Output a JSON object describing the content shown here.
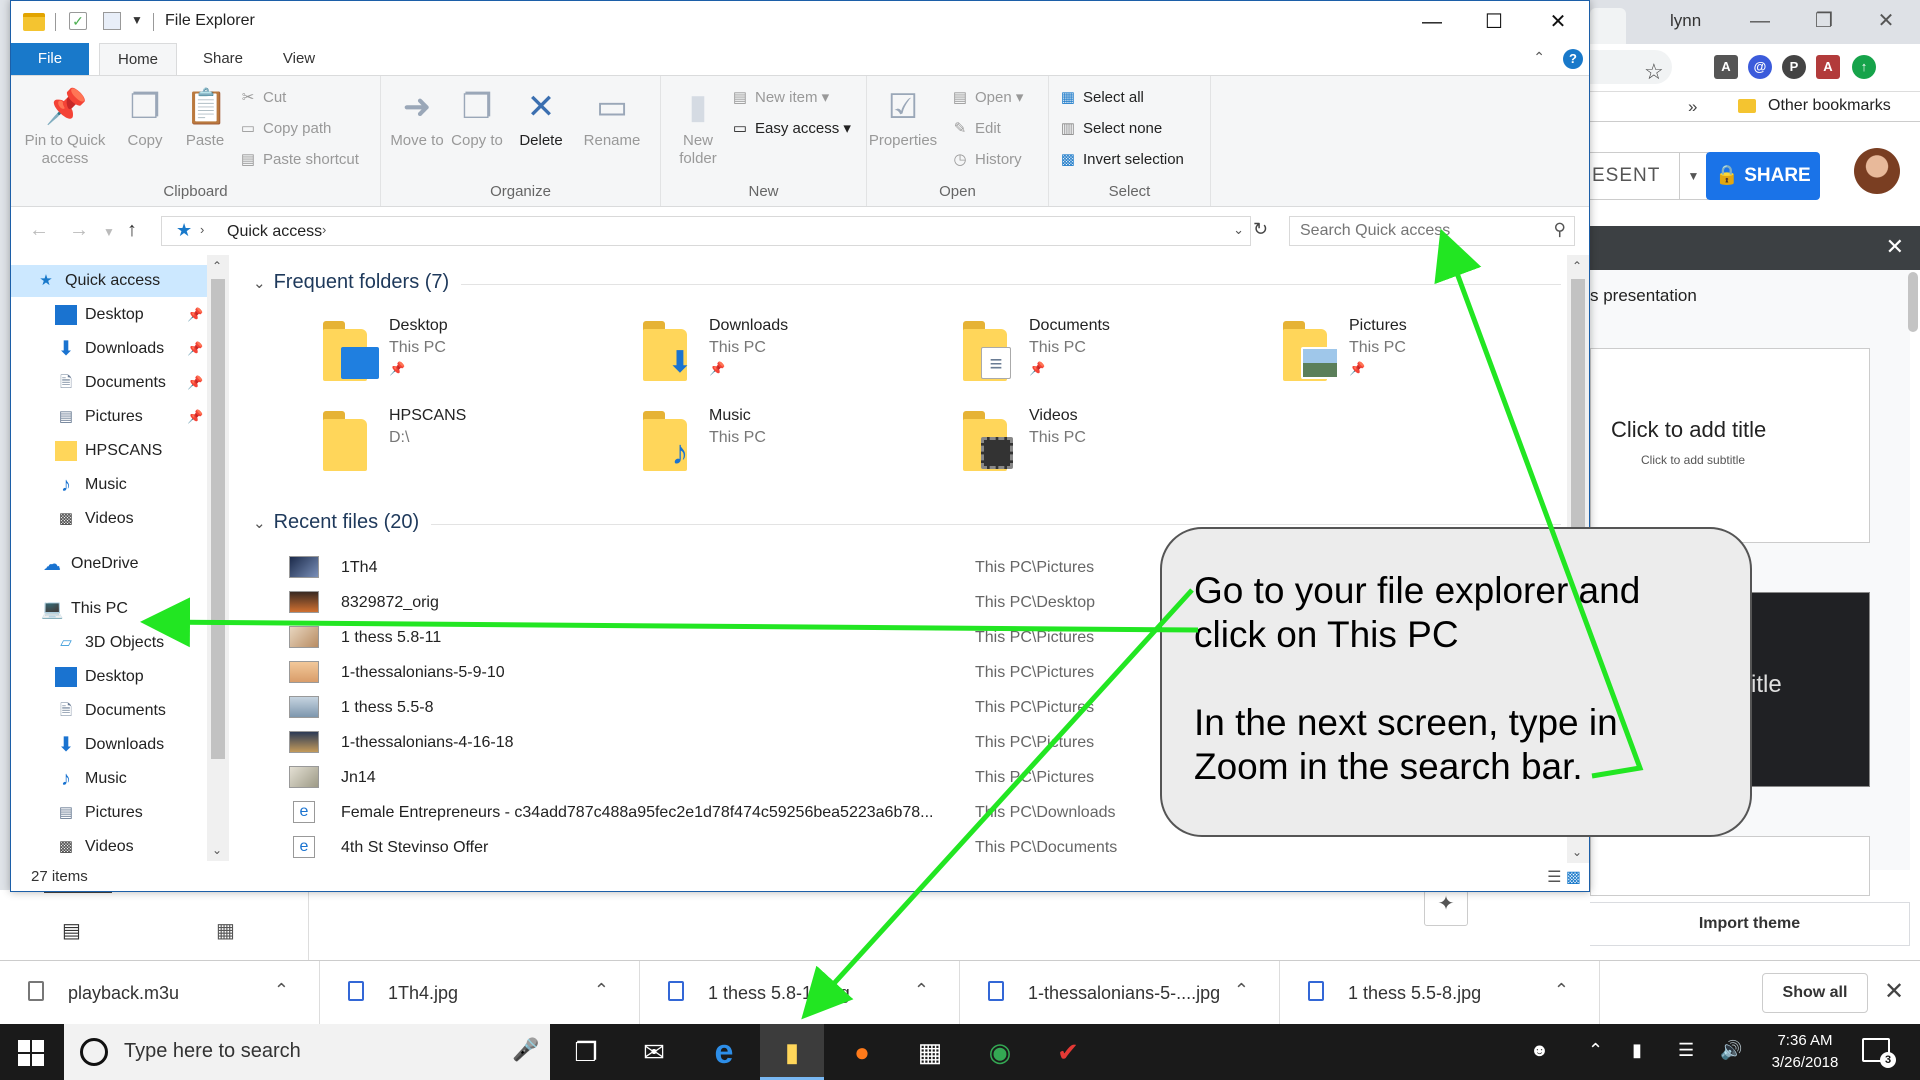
{
  "chrome": {
    "profile_name": "lynn",
    "bookmark_folder": "Other bookmarks",
    "slides": {
      "present_label": "ESENT",
      "share_label": "SHARE",
      "themes_title": "s presentation",
      "slide1_title": "Click to add title",
      "slide1_subtitle": "Click to add subtitle",
      "slide2_title": "itle",
      "import_theme": "Import theme"
    }
  },
  "explorer": {
    "title": "File Explorer",
    "tabs": [
      "File",
      "Home",
      "Share",
      "View"
    ],
    "ribbon": {
      "clipboard": {
        "label": "Clipboard",
        "pin": "Pin to Quick access",
        "copy": "Copy",
        "paste": "Paste",
        "cut": "Cut",
        "copy_path": "Copy path",
        "paste_shortcut": "Paste shortcut"
      },
      "organize": {
        "label": "Organize",
        "move_to": "Move to",
        "copy_to": "Copy to",
        "delete": "Delete",
        "rename": "Rename"
      },
      "new": {
        "label": "New",
        "new_folder": "New folder",
        "new_item": "New item",
        "easy_access": "Easy access"
      },
      "open": {
        "label": "Open",
        "properties": "Properties",
        "open": "Open",
        "edit": "Edit",
        "history": "History"
      },
      "select": {
        "label": "Select",
        "select_all": "Select all",
        "select_none": "Select none",
        "invert_selection": "Invert selection"
      }
    },
    "address": {
      "path": "Quick access",
      "search_placeholder": "Search Quick access"
    },
    "nav": [
      {
        "label": "Quick access",
        "icon": "star-icon"
      },
      {
        "label": "Desktop",
        "icon": "desktop-icon"
      },
      {
        "label": "Downloads",
        "icon": "download-icon"
      },
      {
        "label": "Documents",
        "icon": "documents-icon"
      },
      {
        "label": "Pictures",
        "icon": "pictures-icon"
      },
      {
        "label": "HPSCANS",
        "icon": "folder-icon"
      },
      {
        "label": "Music",
        "icon": "music-icon"
      },
      {
        "label": "Videos",
        "icon": "videos-icon"
      },
      {
        "label": "OneDrive",
        "icon": "onedrive-icon"
      },
      {
        "label": "This PC",
        "icon": "computer-icon"
      },
      {
        "label": "3D Objects",
        "icon": "3d-objects-icon"
      },
      {
        "label": "Desktop",
        "icon": "desktop-icon"
      },
      {
        "label": "Documents",
        "icon": "documents-icon"
      },
      {
        "label": "Downloads",
        "icon": "download-icon"
      },
      {
        "label": "Music",
        "icon": "music-icon"
      },
      {
        "label": "Pictures",
        "icon": "pictures-icon"
      },
      {
        "label": "Videos",
        "icon": "videos-icon"
      }
    ],
    "frequent_header": "Frequent folders (7)",
    "frequent": [
      {
        "name": "Desktop",
        "location": "This PC",
        "pinned": true
      },
      {
        "name": "Downloads",
        "location": "This PC",
        "pinned": true
      },
      {
        "name": "Documents",
        "location": "This PC",
        "pinned": true
      },
      {
        "name": "Pictures",
        "location": "This PC",
        "pinned": true
      },
      {
        "name": "HPSCANS",
        "location": "D:\\",
        "pinned": false
      },
      {
        "name": "Music",
        "location": "This PC",
        "pinned": false
      },
      {
        "name": "Videos",
        "location": "This PC",
        "pinned": false
      }
    ],
    "recent_header": "Recent files (20)",
    "recent": [
      {
        "name": "1Th4",
        "location": "This PC\\Pictures"
      },
      {
        "name": "8329872_orig",
        "location": "This PC\\Desktop"
      },
      {
        "name": "1 thess 5.8-11",
        "location": "This PC\\Pictures"
      },
      {
        "name": "1-thessalonians-5-9-10",
        "location": "This PC\\Pictures"
      },
      {
        "name": "1 thess 5.5-8",
        "location": "This PC\\Pictures"
      },
      {
        "name": "1-thessalonians-4-16-18",
        "location": "This PC\\Pictures"
      },
      {
        "name": "Jn14",
        "location": "This PC\\Pictures"
      },
      {
        "name": "Female Entrepreneurs  - c34add787c488a95fec2e1d78f474c59256bea5223a6b78...",
        "location": "This PC\\Downloads"
      },
      {
        "name": "4th St Stevinso Offer",
        "location": "This PC\\Documents"
      }
    ],
    "status": "27 items"
  },
  "downloads": {
    "items": [
      "playback.m3u",
      "1Th4.jpg",
      "1 thess 5.8-11.jpg",
      "1-thessalonians-5-....jpg",
      "1 thess 5.5-8.jpg"
    ],
    "show_all": "Show all"
  },
  "taskbar": {
    "search_placeholder": "Type here to search",
    "time": "7:36 AM",
    "date": "3/26/2018",
    "notification_count": "3"
  },
  "annotation": {
    "line1": "Go to your file explorer and",
    "line2": "click on This PC",
    "line3": "In the next screen, type in",
    "line4": "Zoom in the search bar."
  },
  "colors": {
    "accent": "#1979ca",
    "selection": "#cce8ff",
    "arrow": "#22e622",
    "share_button": "#1a73e8"
  }
}
